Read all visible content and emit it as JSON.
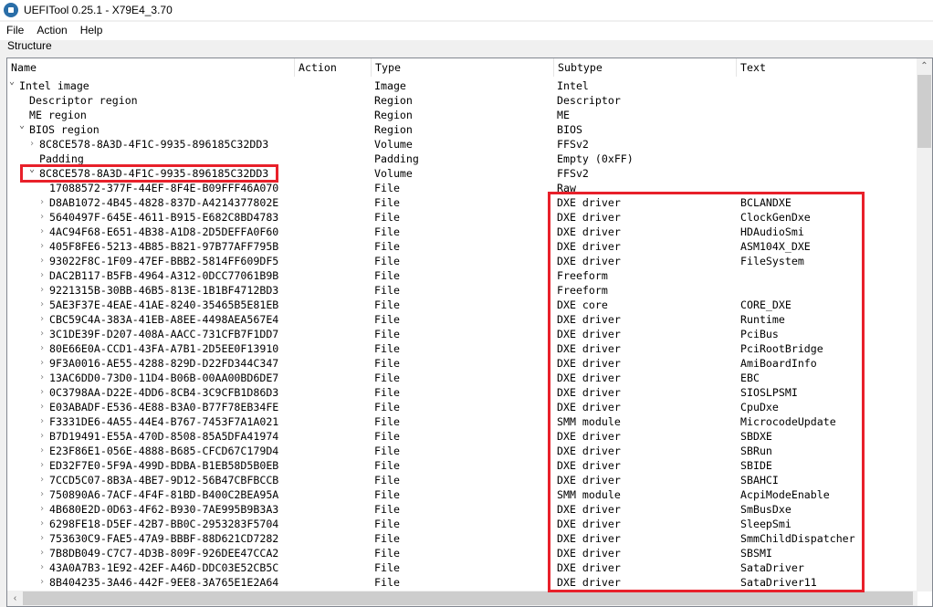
{
  "window": {
    "title": "UEFITool 0.25.1 - X79E4_3.70"
  },
  "menu": [
    "File",
    "Action",
    "Help"
  ],
  "group_label": "Structure",
  "columns": [
    "Name",
    "Action",
    "Type",
    "Subtype",
    "Text"
  ],
  "highlight_color": "#e8202a",
  "rows": [
    {
      "d": 0,
      "e": "open",
      "name": "Intel image",
      "type": "Image",
      "sub": "Intel",
      "text": ""
    },
    {
      "d": 1,
      "e": "",
      "name": "Descriptor region",
      "type": "Region",
      "sub": "Descriptor",
      "text": ""
    },
    {
      "d": 1,
      "e": "",
      "name": "ME region",
      "type": "Region",
      "sub": "ME",
      "text": ""
    },
    {
      "d": 1,
      "e": "open",
      "name": "BIOS region",
      "type": "Region",
      "sub": "BIOS",
      "text": ""
    },
    {
      "d": 2,
      "e": "closed",
      "name": "8C8CE578-8A3D-4F1C-9935-896185C32DD3",
      "type": "Volume",
      "sub": "FFSv2",
      "text": ""
    },
    {
      "d": 2,
      "e": "",
      "name": "Padding",
      "type": "Padding",
      "sub": "Empty (0xFF)",
      "text": ""
    },
    {
      "d": 2,
      "e": "open",
      "name": "8C8CE578-8A3D-4F1C-9935-896185C32DD3",
      "type": "Volume",
      "sub": "FFSv2",
      "text": ""
    },
    {
      "d": 3,
      "e": "",
      "name": "17088572-377F-44EF-8F4E-B09FFF46A070",
      "type": "File",
      "sub": "Raw",
      "text": ""
    },
    {
      "d": 3,
      "e": "closed",
      "name": "D8AB1072-4B45-4828-837D-A4214377802E",
      "type": "File",
      "sub": "DXE driver",
      "text": "BCLANDXE"
    },
    {
      "d": 3,
      "e": "closed",
      "name": "5640497F-645E-4611-B915-E682C8BD4783",
      "type": "File",
      "sub": "DXE driver",
      "text": "ClockGenDxe"
    },
    {
      "d": 3,
      "e": "closed",
      "name": "4AC94F68-E651-4B38-A1D8-2D5DEFFA0F60",
      "type": "File",
      "sub": "DXE driver",
      "text": "HDAudioSmi"
    },
    {
      "d": 3,
      "e": "closed",
      "name": "405F8FE6-5213-4B85-B821-97B77AFF795B",
      "type": "File",
      "sub": "DXE driver",
      "text": "ASM104X_DXE"
    },
    {
      "d": 3,
      "e": "closed",
      "name": "93022F8C-1F09-47EF-BBB2-5814FF609DF5",
      "type": "File",
      "sub": "DXE driver",
      "text": "FileSystem"
    },
    {
      "d": 3,
      "e": "closed",
      "name": "DAC2B117-B5FB-4964-A312-0DCC77061B9B",
      "type": "File",
      "sub": "Freeform",
      "text": ""
    },
    {
      "d": 3,
      "e": "closed",
      "name": "9221315B-30BB-46B5-813E-1B1BF4712BD3",
      "type": "File",
      "sub": "Freeform",
      "text": ""
    },
    {
      "d": 3,
      "e": "closed",
      "name": "5AE3F37E-4EAE-41AE-8240-35465B5E81EB",
      "type": "File",
      "sub": "DXE core",
      "text": "CORE_DXE"
    },
    {
      "d": 3,
      "e": "closed",
      "name": "CBC59C4A-383A-41EB-A8EE-4498AEA567E4",
      "type": "File",
      "sub": "DXE driver",
      "text": "Runtime"
    },
    {
      "d": 3,
      "e": "closed",
      "name": "3C1DE39F-D207-408A-AACC-731CFB7F1DD7",
      "type": "File",
      "sub": "DXE driver",
      "text": "PciBus"
    },
    {
      "d": 3,
      "e": "closed",
      "name": "80E66E0A-CCD1-43FA-A7B1-2D5EE0F13910",
      "type": "File",
      "sub": "DXE driver",
      "text": "PciRootBridge"
    },
    {
      "d": 3,
      "e": "closed",
      "name": "9F3A0016-AE55-4288-829D-D22FD344C347",
      "type": "File",
      "sub": "DXE driver",
      "text": "AmiBoardInfo"
    },
    {
      "d": 3,
      "e": "closed",
      "name": "13AC6DD0-73D0-11D4-B06B-00AA00BD6DE7",
      "type": "File",
      "sub": "DXE driver",
      "text": "EBC"
    },
    {
      "d": 3,
      "e": "closed",
      "name": "0C3798AA-D22E-4DD6-8CB4-3C9CFB1D86D3",
      "type": "File",
      "sub": "DXE driver",
      "text": "SIOSLPSMI"
    },
    {
      "d": 3,
      "e": "closed",
      "name": "E03ABADF-E536-4E88-B3A0-B77F78EB34FE",
      "type": "File",
      "sub": "DXE driver",
      "text": "CpuDxe"
    },
    {
      "d": 3,
      "e": "closed",
      "name": "F3331DE6-4A55-44E4-B767-7453F7A1A021",
      "type": "File",
      "sub": "SMM module",
      "text": "MicrocodeUpdate"
    },
    {
      "d": 3,
      "e": "closed",
      "name": "B7D19491-E55A-470D-8508-85A5DFA41974",
      "type": "File",
      "sub": "DXE driver",
      "text": "SBDXE"
    },
    {
      "d": 3,
      "e": "closed",
      "name": "E23F86E1-056E-4888-B685-CFCD67C179D4",
      "type": "File",
      "sub": "DXE driver",
      "text": "SBRun"
    },
    {
      "d": 3,
      "e": "closed",
      "name": "ED32F7E0-5F9A-499D-BDBA-B1EB58D5B0EB",
      "type": "File",
      "sub": "DXE driver",
      "text": "SBIDE"
    },
    {
      "d": 3,
      "e": "closed",
      "name": "7CCD5C07-8B3A-4BE7-9D12-56B47CBFBCCB",
      "type": "File",
      "sub": "DXE driver",
      "text": "SBAHCI"
    },
    {
      "d": 3,
      "e": "closed",
      "name": "750890A6-7ACF-4F4F-81BD-B400C2BEA95A",
      "type": "File",
      "sub": "SMM module",
      "text": "AcpiModeEnable"
    },
    {
      "d": 3,
      "e": "closed",
      "name": "4B680E2D-0D63-4F62-B930-7AE995B9B3A3",
      "type": "File",
      "sub": "DXE driver",
      "text": "SmBusDxe"
    },
    {
      "d": 3,
      "e": "closed",
      "name": "6298FE18-D5EF-42B7-BB0C-2953283F5704",
      "type": "File",
      "sub": "DXE driver",
      "text": "SleepSmi"
    },
    {
      "d": 3,
      "e": "closed",
      "name": "753630C9-FAE5-47A9-BBBF-88D621CD7282",
      "type": "File",
      "sub": "DXE driver",
      "text": "SmmChildDispatcher"
    },
    {
      "d": 3,
      "e": "closed",
      "name": "7B8DB049-C7C7-4D3B-809F-926DEE47CCA2",
      "type": "File",
      "sub": "DXE driver",
      "text": "SBSMI"
    },
    {
      "d": 3,
      "e": "closed",
      "name": "43A0A7B3-1E92-42EF-A46D-DDC03E52CB5C",
      "type": "File",
      "sub": "DXE driver",
      "text": "SataDriver"
    },
    {
      "d": 3,
      "e": "closed",
      "name": "8B404235-3A46-442F-9EE8-3A765E1E2A64",
      "type": "File",
      "sub": "DXE driver",
      "text": "SataDriver11"
    }
  ]
}
